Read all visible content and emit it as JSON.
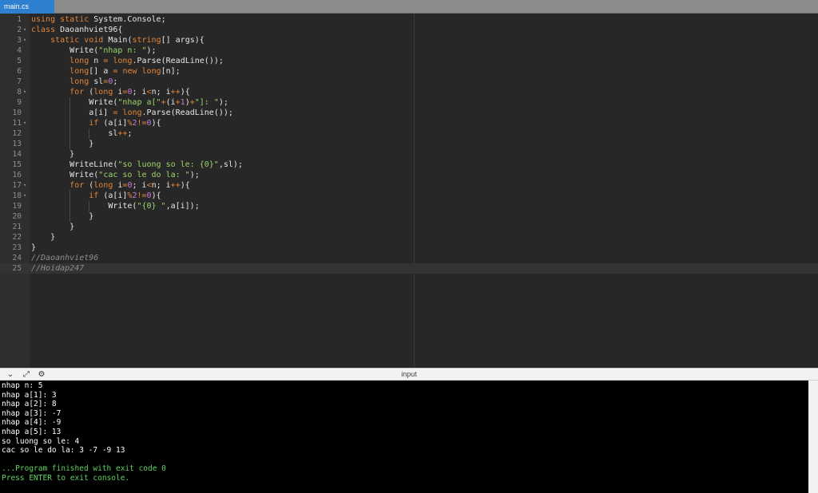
{
  "tab": {
    "label": "main.cs"
  },
  "editor": {
    "lines": [
      {
        "n": "1",
        "fold": "",
        "code": "using static System.Console;"
      },
      {
        "n": "2",
        "fold": "▾",
        "code": "class Daoanhviet96{"
      },
      {
        "n": "3",
        "fold": "▾",
        "code": "    static void Main(string[] args){"
      },
      {
        "n": "4",
        "fold": "",
        "code": "        Write(\"nhap n: \");"
      },
      {
        "n": "5",
        "fold": "",
        "code": "        long n = long.Parse(ReadLine());"
      },
      {
        "n": "6",
        "fold": "",
        "code": "        long[] a = new long[n];"
      },
      {
        "n": "7",
        "fold": "",
        "code": "        long sl=0;"
      },
      {
        "n": "8",
        "fold": "▾",
        "code": "        for (long i=0; i<n; i++){"
      },
      {
        "n": "9",
        "fold": "",
        "code": "            Write(\"nhap a[\"+(i+1)+\"]: \");"
      },
      {
        "n": "10",
        "fold": "",
        "code": "            a[i] = long.Parse(ReadLine());"
      },
      {
        "n": "11",
        "fold": "▾",
        "code": "            if (a[i]%2!=0){"
      },
      {
        "n": "12",
        "fold": "",
        "code": "                sl++;"
      },
      {
        "n": "13",
        "fold": "",
        "code": "            }"
      },
      {
        "n": "14",
        "fold": "",
        "code": "        }"
      },
      {
        "n": "15",
        "fold": "",
        "code": "        WriteLine(\"so luong so le: {0}\",sl);"
      },
      {
        "n": "16",
        "fold": "",
        "code": "        Write(\"cac so le do la: \");"
      },
      {
        "n": "17",
        "fold": "▾",
        "code": "        for (long i=0; i<n; i++){"
      },
      {
        "n": "18",
        "fold": "▾",
        "code": "            if (a[i]%2!=0){"
      },
      {
        "n": "19",
        "fold": "",
        "code": "                Write(\"{0} \",a[i]);"
      },
      {
        "n": "20",
        "fold": "",
        "code": "            }"
      },
      {
        "n": "21",
        "fold": "",
        "code": "        }"
      },
      {
        "n": "22",
        "fold": "",
        "code": "    }"
      },
      {
        "n": "23",
        "fold": "",
        "code": "}"
      },
      {
        "n": "24",
        "fold": "",
        "code": "//Daoanhviet96"
      },
      {
        "n": "25",
        "fold": "",
        "code": "//Hoidap247"
      }
    ],
    "active_line": "25"
  },
  "console": {
    "label": "input",
    "toolbar_icons": [
      "chevron-down-icon",
      "expand-icon",
      "settings-icon"
    ],
    "output": [
      {
        "text": "nhap n: 5",
        "color": "#ffffff"
      },
      {
        "text": "nhap a[1]: 3",
        "color": "#ffffff"
      },
      {
        "text": "nhap a[2]: 8",
        "color": "#ffffff"
      },
      {
        "text": "nhap a[3]: -7",
        "color": "#ffffff"
      },
      {
        "text": "nhap a[4]: -9",
        "color": "#ffffff"
      },
      {
        "text": "nhap a[5]: 13",
        "color": "#ffffff"
      },
      {
        "text": "so luong so le: 4",
        "color": "#ffffff"
      },
      {
        "text": "cac so le do la: 3 -7 -9 13",
        "color": "#ffffff"
      },
      {
        "text": "",
        "color": "#ffffff"
      },
      {
        "text": "...Program finished with exit code 0",
        "color": "#5fd35f"
      },
      {
        "text": "Press ENTER to exit console.",
        "color": "#5fd35f"
      }
    ]
  }
}
